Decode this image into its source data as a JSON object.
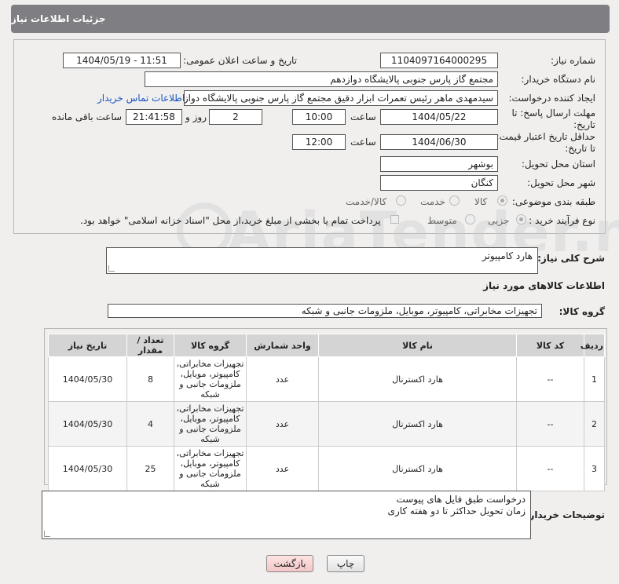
{
  "header": {
    "title": "جزئیات اطلاعات نیاز"
  },
  "fields": {
    "need_number_label": "شماره نیاز:",
    "need_number": "1104097164000295",
    "announce_label": "تاریخ و ساعت اعلان عمومی:",
    "announce_value": "1404/05/19 - 11:51",
    "buyer_label": "نام دستگاه خریدار:",
    "buyer_value": "مجتمع گاز پارس جنوبی  پالایشگاه دوازدهم",
    "creator_label": "ایجاد کننده درخواست:",
    "creator_value": "سیدمهدی ماهر رئیس تعمرات ابزار دقیق مجتمع گاز پارس جنوبی  پالایشگاه دواز",
    "contact_link": "اطلاعات تماس خریدار",
    "deadline_label_1": "مهلت ارسال پاسخ: تا",
    "deadline_label_2": "تاریخ:",
    "deadline_date": "1404/05/22",
    "time_label": "ساعت",
    "deadline_time": "10:00",
    "days_value": "2",
    "days_label": "روز و",
    "remaining_time": "21:41:58",
    "remaining_label": "ساعت باقی مانده",
    "validity_label_1": "حداقل تاریخ اعتبار قیمت:",
    "validity_label_2": "تا تاریخ:",
    "validity_date": "1404/06/30",
    "validity_time": "12:00",
    "province_label": "استان محل تحویل:",
    "province_value": "بوشهر",
    "city_label": "شهر محل تحویل:",
    "city_value": "کنگان",
    "category_label": "طبقه بندی موضوعی:",
    "category_goods": "کالا",
    "category_service": "خدمت",
    "category_both": "کالا/خدمت",
    "process_label": "نوع فرآیند خرید :",
    "process_partial": "جزیی",
    "process_medium": "متوسط",
    "payment_note": "پرداخت تمام یا بخشی از مبلغ خرید،از محل \"اسناد خزانه اسلامی\" خواهد بود."
  },
  "summary": {
    "label": "شرح کلی نیاز:",
    "value": "هارد کامپیوتر"
  },
  "goods_section_title": "اطلاعات کالاهای مورد نیاز",
  "goods_group": {
    "label": "گروه کالا:",
    "value": "تجهیزات مخابراتی، کامپیوتر، موبایل، ملزومات جانبی و شبکه"
  },
  "table": {
    "headers": [
      "ردیف",
      "کد کالا",
      "نام کالا",
      "واحد شمارش",
      "گروه کالا",
      "تعداد / مقدار",
      "تاریخ نیاز"
    ],
    "rows": [
      [
        "1",
        "--",
        "هارد اکسترنال",
        "عدد",
        "تجهیزات مخابراتی، کامپیوتر، موبایل، ملزومات جانبی و شبکه",
        "8",
        "1404/05/30"
      ],
      [
        "2",
        "--",
        "هارد اکسترنال",
        "عدد",
        "تجهیزات مخابراتی، کامپیوتر، موبایل، ملزومات جانبی و شبکه",
        "4",
        "1404/05/30"
      ],
      [
        "3",
        "--",
        "هارد اکسترنال",
        "عدد",
        "تجهیزات مخابراتی، کامپیوتر، موبایل، ملزومات جانبی و شبکه",
        "25",
        "1404/05/30"
      ]
    ]
  },
  "buyer_notes": {
    "label": "توضیحات خریدار:",
    "line1": "درخواست طبق فایل های پیوست",
    "line2": "زمان تحویل حداکثر تا دو هفته کاری"
  },
  "watermark": "AriaTender.neT",
  "buttons": {
    "print": "چاپ",
    "back": "بازگشت"
  }
}
